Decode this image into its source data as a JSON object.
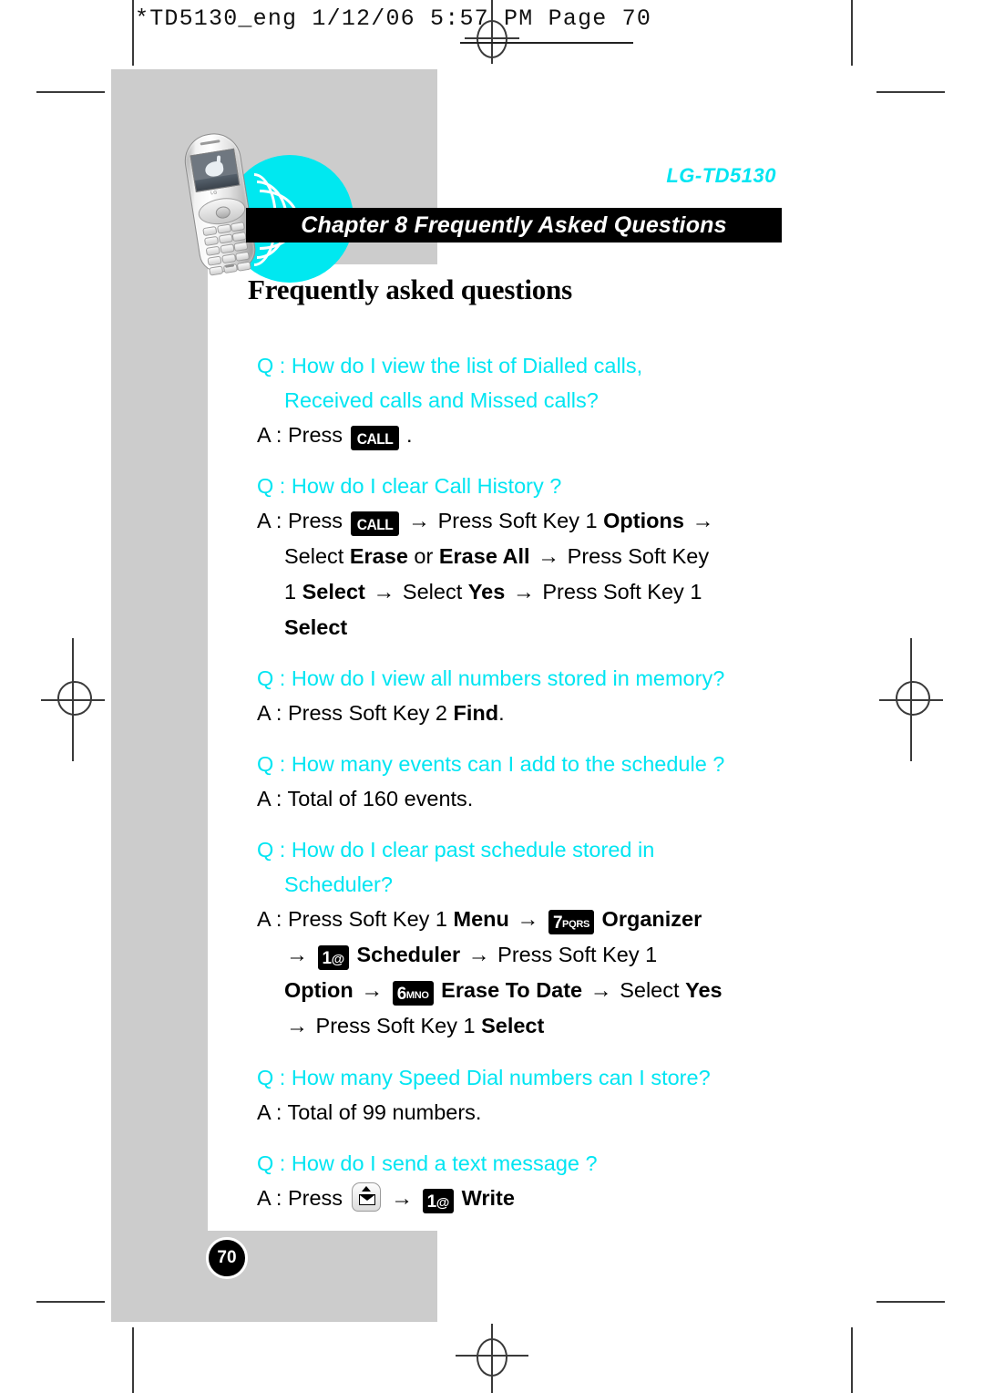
{
  "slug": {
    "text": "*TD5130_eng  1/12/06  5:57 PM  Page 70"
  },
  "brand": {
    "model": "LG-TD5130"
  },
  "banner": {
    "chapter_title": "Chapter 8 Frequently Asked Questions"
  },
  "page": {
    "title": "Frequently asked questions",
    "number": "70"
  },
  "keys": {
    "call": "CALL",
    "one_big": "1",
    "one_sub": "@",
    "six_big": "6",
    "six_sub": "MNO",
    "seven_big": "7",
    "seven_sub": "PQRS",
    "message_icon": "envelope-message-key"
  },
  "colors": {
    "accent_cyan": "#00e5f2",
    "gray_block": "#cccccc",
    "banner_black": "#000000"
  },
  "arrow": "→",
  "faq": [
    {
      "q_line1": "Q : How do I view the list of Dialled calls,",
      "q_line2": "Received calls and Missed calls?",
      "a_prefix": "A : Press",
      "a_suffix": "."
    },
    {
      "q_line1": "Q : How do I clear Call History ?",
      "a_prefix": "A : Press",
      "a_part1": "Press Soft Key 1",
      "a_bold1": "Options",
      "a_part2": "Select",
      "a_bold2": "Erase",
      "a_part3": "or",
      "a_bold3": "Erase All",
      "a_part4": "Press Soft Key",
      "a_part5": "1",
      "a_bold4": "Select",
      "a_part6": "Select",
      "a_bold5": "Yes",
      "a_part7": "Press Soft Key 1",
      "a_bold6": "Select"
    },
    {
      "q_line1": "Q : How do I view all numbers stored in memory?",
      "a_part1": "A : Press Soft Key 2",
      "a_bold1": "Find",
      "a_suffix": "."
    },
    {
      "q_line1": "Q : How many events can I add to the schedule ?",
      "a_text": "A : Total of 160 events."
    },
    {
      "q_line1": "Q : How do I clear past schedule stored in",
      "q_line2": "Scheduler?",
      "a_part1": "A : Press Soft Key 1",
      "a_bold1": "Menu",
      "a_bold2": "Organizer",
      "a_bold3": "Scheduler",
      "a_part2": "Press Soft Key 1",
      "a_bold4": "Option",
      "a_bold5": "Erase To Date",
      "a_part3": "Select",
      "a_bold6": "Yes",
      "a_part4": "Press Soft Key 1",
      "a_bold7": "Select"
    },
    {
      "q_line1": "Q : How many Speed Dial numbers can I store?",
      "a_text": "A : Total of 99 numbers."
    },
    {
      "q_line1": "Q : How do I send a text message ?",
      "a_prefix": "A : Press",
      "a_bold1": "Write"
    }
  ]
}
